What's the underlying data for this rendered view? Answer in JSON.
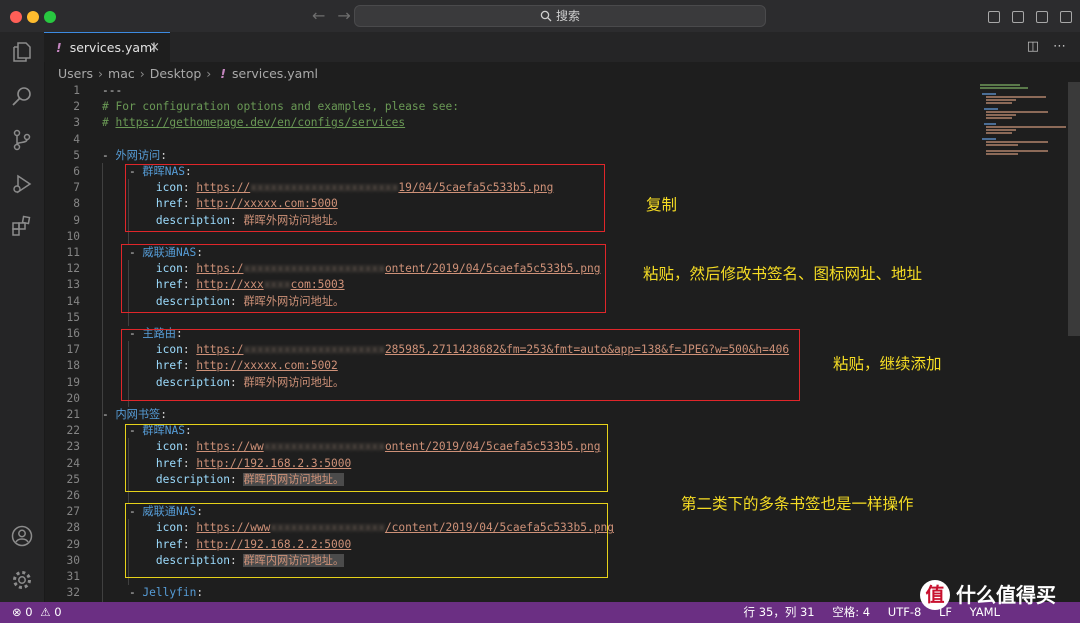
{
  "titlebar": {
    "search_placeholder": "搜索"
  },
  "tab": {
    "filename": "services.yaml",
    "close": "×"
  },
  "breadcrumb": [
    "Users",
    "mac",
    "Desktop",
    "services.yaml"
  ],
  "editor": {
    "lines": [
      {
        "n": "1",
        "parts": [
          [
            "dash",
            "---"
          ]
        ]
      },
      {
        "n": "2",
        "parts": [
          [
            "cm",
            "# For configuration options and examples, please see:"
          ]
        ]
      },
      {
        "n": "3",
        "parts": [
          [
            "cm",
            "# "
          ],
          [
            "cmu",
            "https://gethomepage.dev/en/configs/services"
          ]
        ]
      },
      {
        "n": "4",
        "parts": []
      },
      {
        "n": "5",
        "parts": [
          [
            "dash",
            "- "
          ],
          [
            "key",
            "外网访问"
          ],
          [
            "dash",
            ":"
          ]
        ]
      },
      {
        "n": "6",
        "parts": [
          [
            "dash",
            "    - "
          ],
          [
            "key",
            "群晖NAS"
          ],
          [
            "dash",
            ":"
          ]
        ]
      },
      {
        "n": "7",
        "parts": [
          [
            "sp",
            "        "
          ],
          [
            "ind",
            "icon"
          ],
          [
            "dash",
            ": "
          ],
          [
            "url",
            "https://"
          ],
          [
            "blur",
            "xxxxxxxxxxxxxxxxxxxxxx"
          ],
          [
            "url",
            "19/04/5caefa5c533b5.png"
          ]
        ]
      },
      {
        "n": "8",
        "parts": [
          [
            "sp",
            "        "
          ],
          [
            "ind",
            "href"
          ],
          [
            "dash",
            ": "
          ],
          [
            "url",
            "http://xxxxx.com:5000"
          ]
        ]
      },
      {
        "n": "9",
        "parts": [
          [
            "sp",
            "        "
          ],
          [
            "ind",
            "description"
          ],
          [
            "dash",
            ": "
          ],
          [
            "str",
            "群晖外网访问地址。"
          ]
        ]
      },
      {
        "n": "10",
        "parts": []
      },
      {
        "n": "11",
        "parts": [
          [
            "dash",
            "    - "
          ],
          [
            "key",
            "威联通NAS"
          ],
          [
            "dash",
            ":"
          ]
        ]
      },
      {
        "n": "12",
        "parts": [
          [
            "sp",
            "        "
          ],
          [
            "ind",
            "icon"
          ],
          [
            "dash",
            ": "
          ],
          [
            "url",
            "https:/"
          ],
          [
            "blur",
            "xxxxxxxxxxxxxxxxxxxxx"
          ],
          [
            "url",
            "ontent/2019/04/5caefa5c533b5.png"
          ]
        ]
      },
      {
        "n": "13",
        "parts": [
          [
            "sp",
            "        "
          ],
          [
            "ind",
            "href"
          ],
          [
            "dash",
            ": "
          ],
          [
            "url",
            "http://xxx"
          ],
          [
            "blur",
            "xxxx"
          ],
          [
            "url",
            "com:5003"
          ]
        ]
      },
      {
        "n": "14",
        "parts": [
          [
            "sp",
            "        "
          ],
          [
            "ind",
            "description"
          ],
          [
            "dash",
            ": "
          ],
          [
            "str",
            "群晖外网访问地址。"
          ]
        ]
      },
      {
        "n": "15",
        "parts": []
      },
      {
        "n": "16",
        "parts": [
          [
            "dash",
            "    - "
          ],
          [
            "key",
            "主路由"
          ],
          [
            "dash",
            ":"
          ]
        ]
      },
      {
        "n": "17",
        "parts": [
          [
            "sp",
            "        "
          ],
          [
            "ind",
            "icon"
          ],
          [
            "dash",
            ": "
          ],
          [
            "url",
            "https:/"
          ],
          [
            "blur",
            "xxxxxxxxxxxxxxxxxxxxx"
          ],
          [
            "url",
            "285985,2711428682&fm=253&fmt=auto&app=138&f=JPEG?w=500&h=406"
          ]
        ]
      },
      {
        "n": "18",
        "parts": [
          [
            "sp",
            "        "
          ],
          [
            "ind",
            "href"
          ],
          [
            "dash",
            ": "
          ],
          [
            "url",
            "http://xxxxx.com:5002"
          ]
        ]
      },
      {
        "n": "19",
        "parts": [
          [
            "sp",
            "        "
          ],
          [
            "ind",
            "description"
          ],
          [
            "dash",
            ": "
          ],
          [
            "str",
            "群晖外网访问地址。"
          ]
        ]
      },
      {
        "n": "20",
        "parts": []
      },
      {
        "n": "21",
        "parts": [
          [
            "dash",
            "- "
          ],
          [
            "key",
            "内网书签"
          ],
          [
            "dash",
            ":"
          ]
        ]
      },
      {
        "n": "22",
        "parts": [
          [
            "dash",
            "    - "
          ],
          [
            "key",
            "群晖NAS"
          ],
          [
            "dash",
            ":"
          ]
        ]
      },
      {
        "n": "23",
        "parts": [
          [
            "sp",
            "        "
          ],
          [
            "ind",
            "icon"
          ],
          [
            "dash",
            ": "
          ],
          [
            "url",
            "https://ww"
          ],
          [
            "blur",
            "xxxxxxxxxxxxxxxxxx"
          ],
          [
            "url",
            "ontent/2019/04/5caefa5c533b5.png"
          ]
        ]
      },
      {
        "n": "24",
        "parts": [
          [
            "sp",
            "        "
          ],
          [
            "ind",
            "href"
          ],
          [
            "dash",
            ": "
          ],
          [
            "url",
            "http://192.168.2.3:5000"
          ]
        ]
      },
      {
        "n": "25",
        "parts": [
          [
            "sp",
            "        "
          ],
          [
            "ind",
            "description"
          ],
          [
            "dash",
            ": "
          ],
          [
            "cnhl",
            "群晖内网访问地址。"
          ]
        ]
      },
      {
        "n": "26",
        "parts": []
      },
      {
        "n": "27",
        "parts": [
          [
            "dash",
            "    - "
          ],
          [
            "key",
            "威联通NAS"
          ],
          [
            "dash",
            ":"
          ]
        ]
      },
      {
        "n": "28",
        "parts": [
          [
            "sp",
            "        "
          ],
          [
            "ind",
            "icon"
          ],
          [
            "dash",
            ": "
          ],
          [
            "url",
            "https://www"
          ],
          [
            "blur",
            "xxxxxxxxxxxxxxxxx"
          ],
          [
            "url",
            "/content/2019/04/5caefa5c533b5.png"
          ]
        ]
      },
      {
        "n": "29",
        "parts": [
          [
            "sp",
            "        "
          ],
          [
            "ind",
            "href"
          ],
          [
            "dash",
            ": "
          ],
          [
            "url",
            "http://192.168.2.2:5000"
          ]
        ]
      },
      {
        "n": "30",
        "parts": [
          [
            "sp",
            "        "
          ],
          [
            "ind",
            "description"
          ],
          [
            "dash",
            ": "
          ],
          [
            "cnhl",
            "群晖内网访问地址。"
          ]
        ]
      },
      {
        "n": "31",
        "parts": []
      },
      {
        "n": "32",
        "parts": [
          [
            "dash",
            "    - "
          ],
          [
            "key",
            "Jellyfin"
          ],
          [
            "dash",
            ":"
          ]
        ]
      }
    ]
  },
  "annotations": {
    "copy": "复制",
    "paste_modify": "粘贴，然后修改书签名、图标网址、地址",
    "paste_continue": "粘贴，继续添加",
    "same_op": "第二类下的多条书签也是一样操作"
  },
  "status": {
    "errors": "0",
    "warnings": "0",
    "position": "行 35，列 31",
    "spaces": "空格: 4",
    "encoding": "UTF-8",
    "eol": "LF",
    "language": "YAML"
  },
  "watermark": {
    "logo": "值",
    "text": "什么值得买"
  }
}
